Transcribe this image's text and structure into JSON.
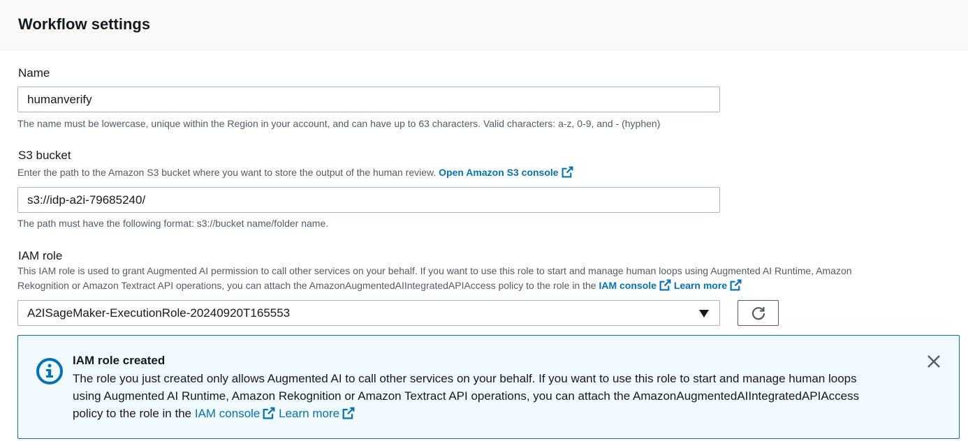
{
  "panel": {
    "title": "Workflow settings"
  },
  "name_field": {
    "label": "Name",
    "value": "humanverify",
    "hint": "The name must be lowercase, unique within the Region in your account, and can have up to 63 characters. Valid characters: a-z, 0-9, and - (hyphen)"
  },
  "s3_field": {
    "label": "S3 bucket",
    "description": "Enter the path to the Amazon S3 bucket where you want to store the output of the human review.",
    "link_label": "Open Amazon S3 console",
    "value": "s3://idp-a2i-79685240/",
    "hint": "The path must have the following format: s3://bucket name/folder name."
  },
  "iam_field": {
    "label": "IAM role",
    "description_line1": "This IAM role is used to grant Augmented AI permission to call other services on your behalf. If you want to use this role to start and manage human loops using Augmented AI Runtime, Amazon",
    "description_line2": "Rekognition or Amazon Textract API operations, you can attach the AmazonAugmentedAIIntegratedAPIAccess policy to the role in the",
    "iam_console_link": "IAM console",
    "learn_more_link": "Learn more",
    "selected_value": "A2ISageMaker-ExecutionRole-20240920T165553"
  },
  "alert": {
    "title": "IAM role created",
    "line1": "The role you just created only allows Augmented AI to call other services on your behalf. If you want to use this role to start and manage human loops",
    "line2": "using Augmented AI Runtime, Amazon Rekognition or Amazon Textract API operations, you can attach the AmazonAugmentedAIIntegratedAPIAccess",
    "line3_prefix": "policy to the role in the",
    "iam_console_link": "IAM console",
    "learn_more_link": "Learn more"
  },
  "colors": {
    "link": "#0073bb",
    "alert_border": "#0073bb",
    "alert_background": "#f1faff",
    "text": "#16191f",
    "hint_text": "#545b64"
  },
  "icons": {
    "external_link": "external-link-icon",
    "refresh": "refresh-icon",
    "dropdown": "caret-down-icon",
    "info": "info-icon",
    "close": "close-icon"
  }
}
